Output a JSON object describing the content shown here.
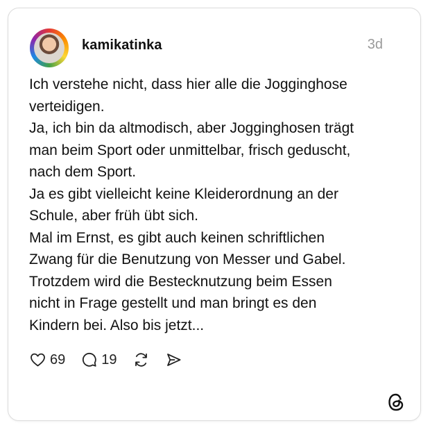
{
  "post": {
    "username": "kamikatinka",
    "time": "3d",
    "lines": [
      "Ich verstehe nicht, dass hier alle die Jogginghose",
      "verteidigen.",
      "Ja, ich bin da altmodisch, aber Jogginghosen trägt",
      "man beim Sport oder unmittelbar, frisch geduscht,",
      "nach dem Sport.",
      "Ja es gibt vielleicht keine Kleiderordnung an der",
      "Schule, aber früh übt sich.",
      "Mal im Ernst, es gibt auch keinen schriftlichen",
      "Zwang für die Benutzung von Messer und Gabel.",
      "Trotzdem wird die Bestecknutzung beim Essen",
      "nicht in Frage gestellt und man bringt es den",
      "Kindern bei. Also bis jetzt..."
    ]
  },
  "actions": {
    "likes": "69",
    "replies": "19",
    "icons": [
      "heart-icon",
      "comment-icon",
      "repost-icon",
      "share-icon"
    ]
  },
  "brand": {
    "logo_icon": "threads-logo-icon",
    "text_color": "#111111",
    "muted_color": "#999999"
  }
}
